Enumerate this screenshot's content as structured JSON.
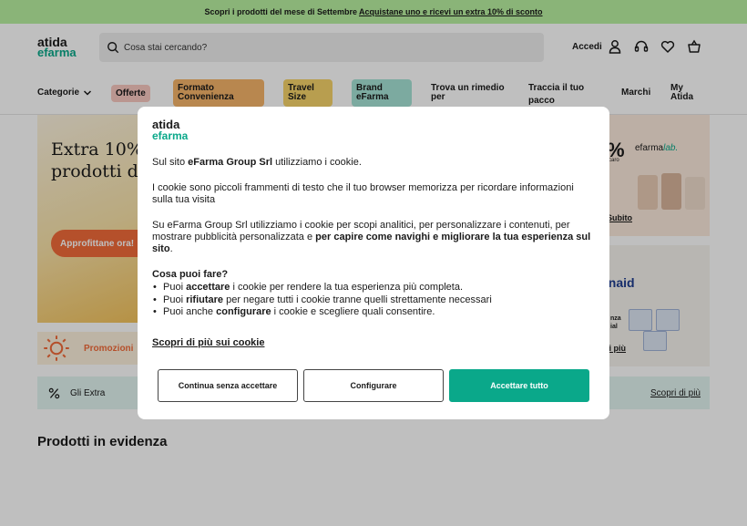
{
  "promo_bar": {
    "text": "Scopri i prodotti del mese di Settembre",
    "link": "Acquistane uno e ricevi un extra 10% di sconto"
  },
  "header": {
    "logo_top": "atida",
    "logo_bottom": "efarma",
    "search_placeholder": "Cosa stai cercando?",
    "accedi": "Accedi"
  },
  "nav": {
    "categorie": "Categorie",
    "offerte": "Offerte",
    "formato_l1": "Formato",
    "formato_l2": "Convenienza",
    "travel_l1": "Travel",
    "travel_l2": "Size",
    "brand_l1": "Brand",
    "brand_l2": "eFarma",
    "trova_l1": "Trova un rimedio",
    "trova_l2": "per",
    "traccia_l1": "Traccia il tuo",
    "traccia_l2": "pacco",
    "marchi": "Marchi",
    "my_l1": "My",
    "my_l2": "Atida"
  },
  "page": {
    "hero_title_l1": "Extra 10%",
    "hero_title_l2": "prodotti d",
    "hero_cta": "Approfittane ora!",
    "promozioni": "Promozioni",
    "gli_extra": "Gli Extra",
    "scopri_di_piu": "Scopri di più",
    "section_title": "Prodotti in evidenza",
    "right_top_brand_a": "efarma",
    "right_top_brand_b": "lab.",
    "right_top_pct": "%",
    "right_top_small": "caro",
    "right_top_link": "Subito",
    "right_bot_title": "enaid",
    "right_bot_small_1": "nza",
    "right_bot_small_2": "ial",
    "right_bot_link": "li più"
  },
  "cookie_modal": {
    "logo_top": "atida",
    "logo_bottom": "efarma",
    "intro_pre": "Sul sito ",
    "intro_company": "eFarma Group Srl",
    "intro_post": " utilizziamo i cookie.",
    "what": "I cookie sono piccoli frammenti di testo che il tuo browser memorizza per ricordare informazioni sulla tua visita",
    "use_pre": "Su eFarma Group Srl utilizziamo i cookie per scopi analitici, per personalizzare i contenuti, per mostrare pubblicità personalizzata e ",
    "use_bold": "per capire come navighi e migliorare la tua esperienza sul sito",
    "use_post": ".",
    "question": "Cosa puoi fare?",
    "opt1_pre": "Puoi ",
    "opt1_bold": "accettare",
    "opt1_post": " i cookie per rendere la tua esperienza più completa.",
    "opt2_pre": "Puoi ",
    "opt2_bold": "rifiutare",
    "opt2_post": " per negare tutti i cookie tranne quelli strettamente necessari",
    "opt3_pre": "Puoi anche ",
    "opt3_bold": "configurare",
    "opt3_post": " i cookie e scegliere quali consentire.",
    "more_link": "Scopri di più sui cookie",
    "btn_continue": "Continua senza accettare",
    "btn_configure": "Configurare",
    "btn_accept": "Accettare tutto"
  },
  "colors": {
    "brand_green": "#0aa88a",
    "promo_bar": "#b9f0a0",
    "offerte_pill": "#f9c9c0",
    "formato_pill": "#f6b46a",
    "travel_pill": "#f6d36a",
    "brand_pill": "#a6e3d6",
    "hero_cta": "#f26b3a"
  },
  "icons": {
    "search": "search-icon",
    "user": "user-icon",
    "headset": "headset-icon",
    "heart": "heart-icon",
    "basket": "basket-icon",
    "chevron": "chevron-down-icon",
    "sun": "sun-icon",
    "percent": "percent-icon"
  }
}
